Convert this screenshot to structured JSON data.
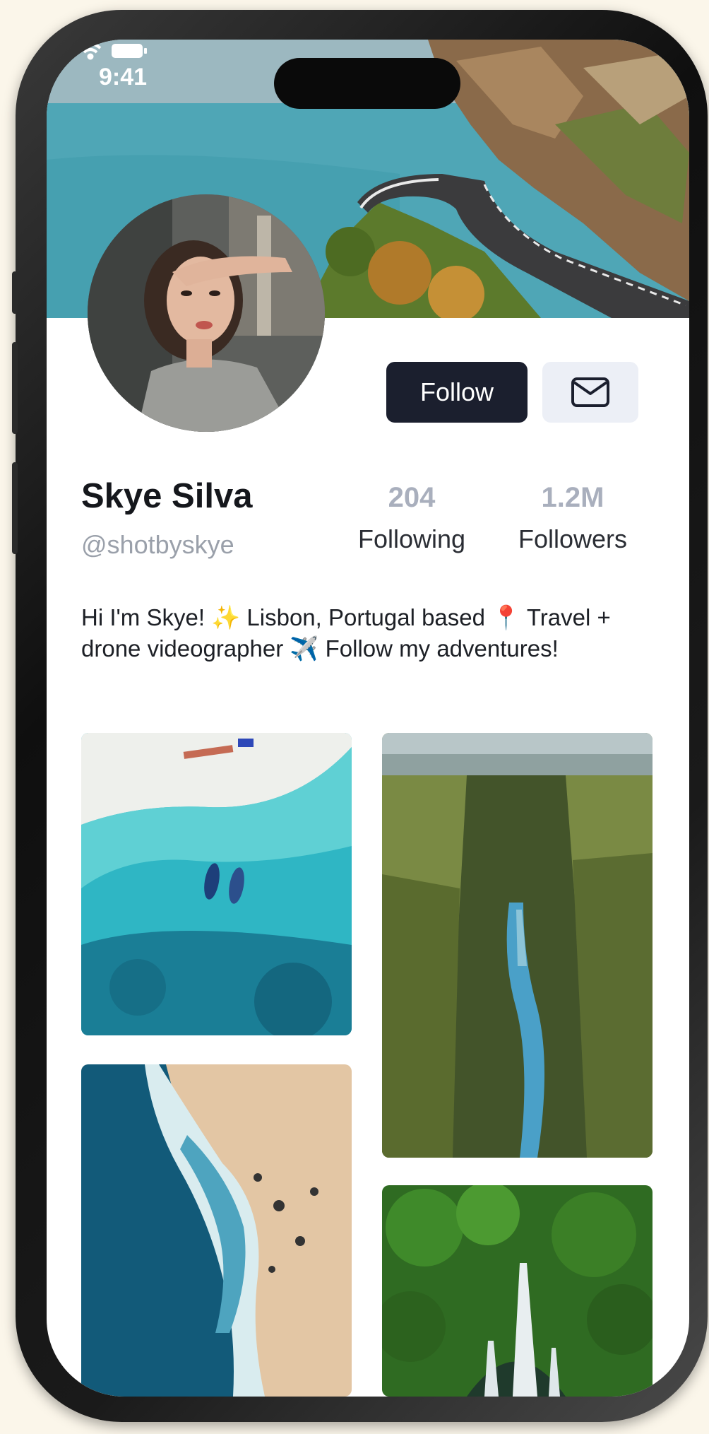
{
  "status_bar": {
    "time": "9:41"
  },
  "profile": {
    "name": "Skye Silva",
    "handle": "@shotbyskye",
    "follow_label": "Follow",
    "stats": [
      {
        "value": "204",
        "label": "Following"
      },
      {
        "value": "1.2M",
        "label": "Followers"
      }
    ],
    "bio_line1": "Hi I'm Skye! ✨ Lisbon, Portugal based 📍 Travel +",
    "bio_line2": "drone videographer ✈️ Follow my adventures!"
  },
  "icons": {
    "message": "envelope-icon",
    "status": [
      "signal-icon",
      "wifi-icon",
      "battery-icon"
    ]
  },
  "colors": {
    "follow_button": "#1b1f2e",
    "message_button": "#eceff6",
    "stat_number": "#a9afbd",
    "handle": "#9aa0aa"
  }
}
